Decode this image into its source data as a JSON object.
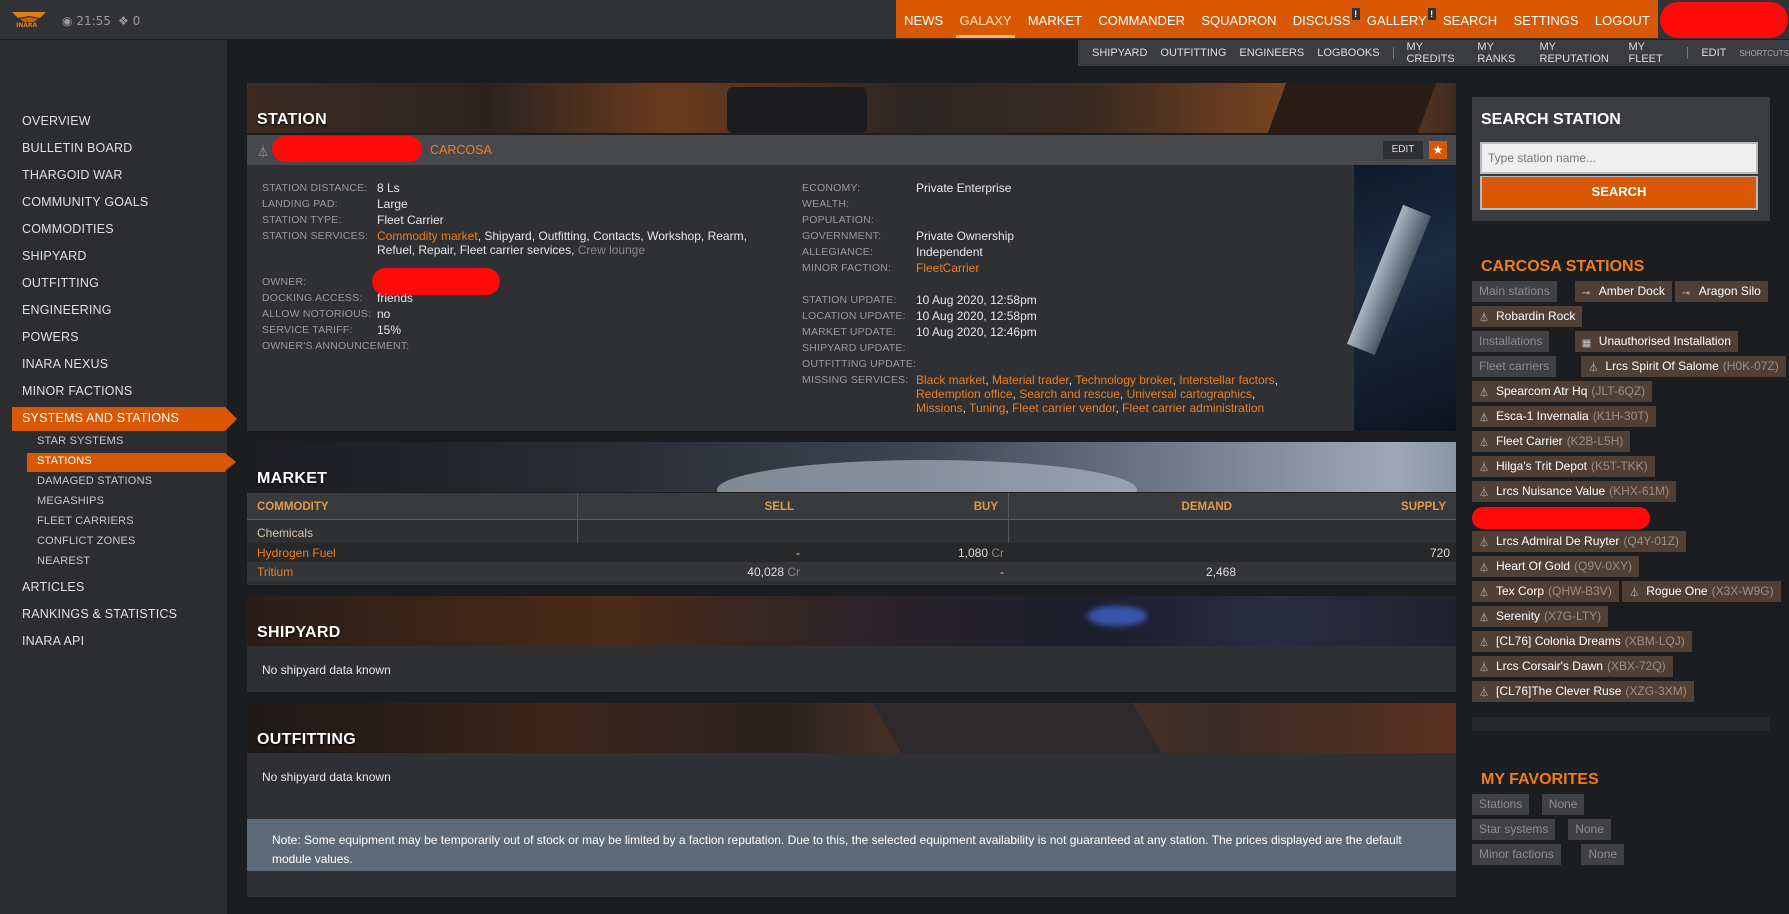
{
  "topbar": {
    "logo_text": "INARA",
    "clock": "21:55",
    "messages": "0"
  },
  "nav": {
    "items": [
      {
        "label": "NEWS",
        "active": false,
        "bang": false
      },
      {
        "label": "GALAXY",
        "active": true,
        "bang": false
      },
      {
        "label": "MARKET",
        "active": false,
        "bang": false
      },
      {
        "label": "COMMANDER",
        "active": false,
        "bang": false
      },
      {
        "label": "SQUADRON",
        "active": false,
        "bang": false
      },
      {
        "label": "DISCUSS",
        "active": false,
        "bang": true
      },
      {
        "label": "GALLERY",
        "active": false,
        "bang": true
      },
      {
        "label": "SEARCH",
        "active": false,
        "bang": false
      },
      {
        "label": "SETTINGS",
        "active": false,
        "bang": false
      },
      {
        "label": "LOGOUT",
        "active": false,
        "bang": false
      }
    ],
    "bang": "!"
  },
  "subnav": {
    "group1": [
      "SHIPYARD",
      "OUTFITTING",
      "ENGINEERS",
      "LOGBOOKS"
    ],
    "group2": [
      "MY CREDITS",
      "MY RANKS",
      "MY REPUTATION",
      "MY FLEET"
    ],
    "edit": "EDIT",
    "shortcuts": "SHORTCUTS"
  },
  "sidebar": {
    "items": [
      "OVERVIEW",
      "BULLETIN BOARD",
      "THARGOID WAR",
      "COMMUNITY GOALS",
      "COMMODITIES",
      "SHIPYARD",
      "OUTFITTING",
      "ENGINEERING",
      "POWERS",
      "INARA NEXUS",
      "MINOR FACTIONS",
      "SYSTEMS AND STATIONS"
    ],
    "subitems": [
      "STAR SYSTEMS",
      "STATIONS",
      "DAMAGED STATIONS",
      "MEGASHIPS",
      "FLEET CARRIERS",
      "CONFLICT ZONES",
      "NEAREST"
    ],
    "bottom": [
      "ARTICLES",
      "RANKINGS & STATISTICS",
      "INARA API"
    ]
  },
  "station": {
    "section_title": "STATION",
    "system_link": "CARCOSA",
    "edit_label": "EDIT",
    "labels": {
      "distance": "STATION DISTANCE:",
      "pad": "LANDING PAD:",
      "type": "STATION TYPE:",
      "services": "STATION SERVICES:",
      "owner": "OWNER:",
      "docking": "DOCKING ACCESS:",
      "notorious": "ALLOW NOTORIOUS:",
      "tariff": "SERVICE TARIFF:",
      "announcement": "OWNER'S ANNOUNCEMENT:",
      "economy": "ECONOMY:",
      "wealth": "WEALTH:",
      "population": "POPULATION:",
      "government": "GOVERNMENT:",
      "allegiance": "ALLEGIANCE:",
      "minor_faction": "MINOR FACTION:",
      "station_update": "STATION UPDATE:",
      "location_update": "LOCATION UPDATE:",
      "market_update": "MARKET UPDATE:",
      "shipyard_update": "SHIPYARD UPDATE:",
      "outfitting_update": "OUTFITTING UPDATE:",
      "missing": "MISSING SERVICES:"
    },
    "values": {
      "distance": "8 Ls",
      "pad": "Large",
      "type": "Fleet Carrier",
      "services_link": "Commodity market",
      "services_line1": ", Shipyard, Outfitting, Contacts, Workshop, Rearm,",
      "services_line2": "Refuel, Repair, Fleet carrier services, ",
      "services_gray": "Crew lounge",
      "docking": "friends",
      "notorious": "no",
      "tariff": "15%",
      "economy": "Private Enterprise",
      "government": "Private Ownership",
      "allegiance": "Independent",
      "minor_faction": "FleetCarrier",
      "station_update": "10 Aug 2020, 12:58pm",
      "location_update": "10 Aug 2020, 12:58pm",
      "market_update": "10 Aug 2020, 12:46pm"
    },
    "missing_services": [
      [
        "Black market",
        ", ",
        "Material trader",
        ", ",
        "Technology broker",
        ", ",
        "Interstellar factors",
        ","
      ],
      [
        "Redemption office",
        ", ",
        "Search and rescue",
        ", ",
        "Universal cartographics",
        ","
      ],
      [
        "Missions",
        ", ",
        "Tuning",
        ", ",
        "Fleet carrier vendor",
        ", ",
        "Fleet carrier administration"
      ]
    ]
  },
  "market": {
    "section_title": "MARKET",
    "headers": {
      "commodity": "COMMODITY",
      "sell": "SELL",
      "buy": "BUY",
      "demand": "DEMAND",
      "supply": "SUPPLY"
    },
    "category": "Chemicals",
    "rows": [
      {
        "name": "Hydrogen Fuel",
        "sell": "-",
        "sell_unit": "",
        "buy": "1,080",
        "buy_unit": " Cr",
        "demand": "",
        "supply": "720"
      },
      {
        "name": "Tritium",
        "sell": "40,028",
        "sell_unit": " Cr",
        "buy": "-",
        "buy_unit": "",
        "demand": "2,468",
        "supply": ""
      }
    ]
  },
  "shipyard": {
    "section_title": "SHIPYARD",
    "empty": "No shipyard data known"
  },
  "outfitting": {
    "section_title": "OUTFITTING",
    "empty": "No shipyard data known",
    "note": "Note: Some equipment may be temporarily out of stock or may be limited by a faction reputation. Due to this, the selected equipment availability is not guaranteed at any station. The prices displayed are the default module values."
  },
  "search": {
    "title": "SEARCH STATION",
    "placeholder": "Type station name...",
    "button": "SEARCH"
  },
  "carcosa": {
    "title": "CARCOSA STATIONS",
    "main_label": "Main stations",
    "installations_label": "Installations",
    "fleet_label": "Fleet carriers",
    "main": [
      "Amber Dock",
      "Aragon Silo",
      "Robardin Rock"
    ],
    "installations": [
      "Unauthorised Installation"
    ],
    "carriers": [
      {
        "name": "Lrcs Spirit Of Salome",
        "code": "(H0K-07Z)"
      },
      {
        "name": "Spearcom Atr Hq",
        "code": "(JLT-6QZ)"
      },
      {
        "name": "Esca-1 Invernalia",
        "code": "(K1H-30T)"
      },
      {
        "name": "Fleet Carrier",
        "code": "(K2B-L5H)"
      },
      {
        "name": "Hilga's Trit Depot",
        "code": "(K5T-TKK)"
      },
      {
        "name": "Lrcs Nuisance Value",
        "code": "(KHX-61M)"
      },
      {
        "name": "Lrcs Admiral De Ruyter",
        "code": "(Q4Y-01Z)"
      },
      {
        "name": "Heart Of Gold",
        "code": "(Q9V-0XY)"
      },
      {
        "name": "Tex Corp",
        "code": "(QHW-B3V)"
      },
      {
        "name": "Rogue One",
        "code": "(X3X-W9G)"
      },
      {
        "name": "Serenity",
        "code": "(X7G-LTY)"
      },
      {
        "name": "[CL76] Colonia Dreams",
        "code": "(XBM-LQJ)"
      },
      {
        "name": "Lrcs Corsair's Dawn",
        "code": "(XBX-72Q)"
      },
      {
        "name": "[CL76]The Clever Ruse",
        "code": "(XZG-3XM)"
      }
    ]
  },
  "favorites": {
    "title": "MY FAVORITES",
    "rows": [
      {
        "label": "Stations",
        "value": "None"
      },
      {
        "label": "Star systems",
        "value": "None"
      },
      {
        "label": "Minor factions",
        "value": "None"
      }
    ]
  },
  "colors": {
    "accent": "#d95806",
    "link": "#f07d1a",
    "panel": "#2e3034",
    "page": "#1b1d20"
  },
  "icons": {
    "logo": "inara-logo",
    "clock": "clock-icon",
    "msg": "chat-icon",
    "carrier": "fleet-carrier-icon",
    "outpost": "outpost-icon",
    "install": "installation-icon",
    "star": "star-icon"
  }
}
